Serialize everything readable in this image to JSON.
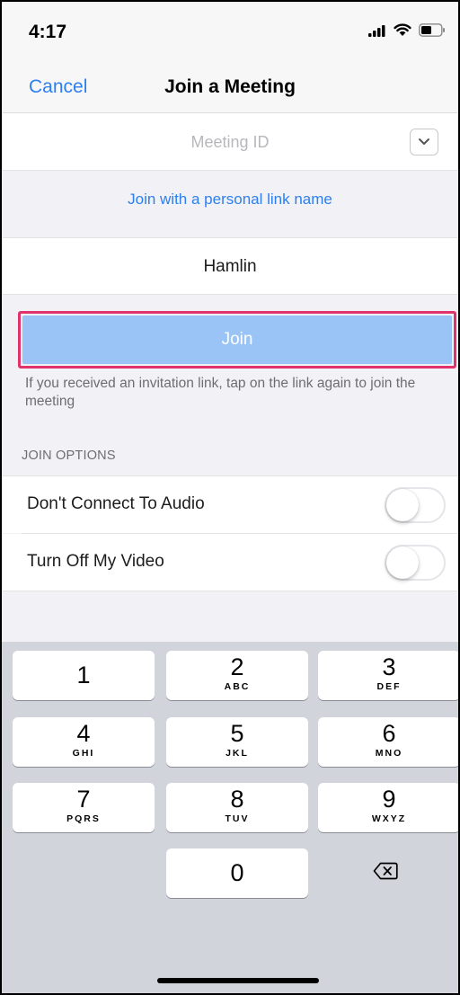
{
  "status_bar": {
    "time": "4:17"
  },
  "nav": {
    "cancel_label": "Cancel",
    "title": "Join a Meeting"
  },
  "meeting_id": {
    "value": "",
    "placeholder": "Meeting ID"
  },
  "personal_link_label": "Join with a personal link name",
  "name_field": {
    "value": "Hamlin"
  },
  "join_button_label": "Join",
  "hint_text": "If you received an invitation link, tap on the link again to join the meeting",
  "join_options": {
    "header": "JOIN OPTIONS",
    "items": [
      {
        "label": "Don't Connect To Audio",
        "enabled": false
      },
      {
        "label": "Turn Off My Video",
        "enabled": false
      }
    ]
  },
  "keypad": {
    "keys": [
      {
        "num": "1",
        "letters": ""
      },
      {
        "num": "2",
        "letters": "ABC"
      },
      {
        "num": "3",
        "letters": "DEF"
      },
      {
        "num": "4",
        "letters": "GHI"
      },
      {
        "num": "5",
        "letters": "JKL"
      },
      {
        "num": "6",
        "letters": "MNO"
      },
      {
        "num": "7",
        "letters": "PQRS"
      },
      {
        "num": "8",
        "letters": "TUV"
      },
      {
        "num": "9",
        "letters": "WXYZ"
      },
      {
        "num": "0",
        "letters": ""
      }
    ]
  },
  "colors": {
    "accent": "#2d7ff0",
    "join_button": "#9ac4f5",
    "highlight_border": "#e0336b",
    "keyboard_bg": "#d1d4db"
  }
}
